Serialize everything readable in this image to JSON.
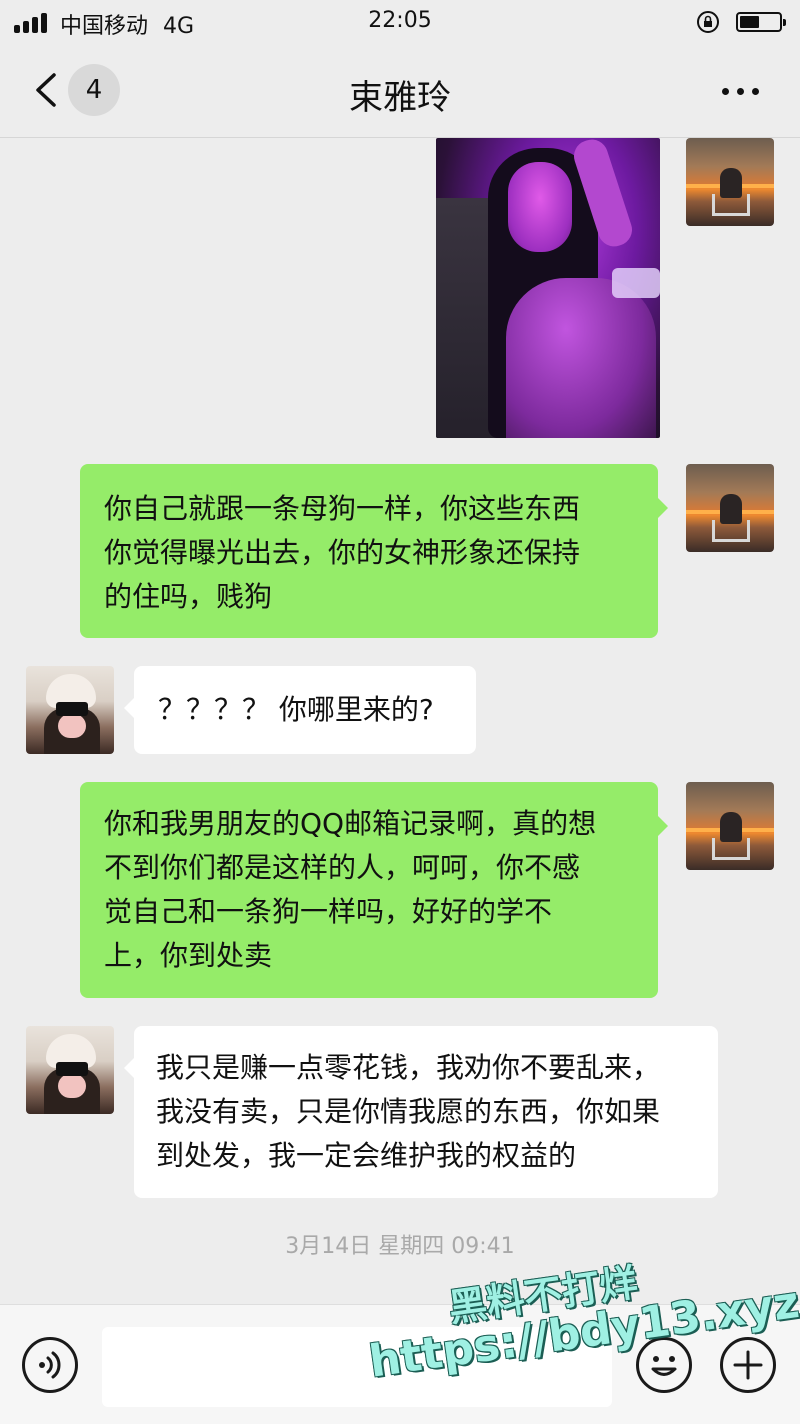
{
  "status_bar": {
    "carrier": "中国移动",
    "network": "4G",
    "time": "22:05",
    "battery_level": 0.5
  },
  "nav": {
    "back_badge": "4",
    "title": "束雅玲"
  },
  "messages": [
    {
      "sender": "self",
      "type": "image"
    },
    {
      "sender": "self",
      "type": "text",
      "lines": [
        "你自己就跟一条母狗一样，你这些东西",
        "你觉得曝光出去，你的女神形象还保持",
        "的住吗，贱狗"
      ]
    },
    {
      "sender": "other",
      "type": "text",
      "lines": [
        "？？？？ 你哪里来的?"
      ]
    },
    {
      "sender": "self",
      "type": "text",
      "lines": [
        "你和我男朋友的QQ邮箱记录啊，真的想",
        "不到你们都是这样的人，呵呵，你不感",
        "觉自己和一条狗一样吗，好好的学不",
        "上，你到处卖"
      ]
    },
    {
      "sender": "other",
      "type": "text",
      "lines": [
        "我只是赚一点零花钱，我劝你不要乱来，",
        "我没有卖，只是你情我愿的东西，你如果",
        "到处发，我一定会维护我的权益的"
      ]
    }
  ],
  "timestamp": "3月14日 星期四 09:41",
  "input": {
    "value": ""
  },
  "watermark": {
    "line1": "黑料不打烊",
    "line2": "https://bdy13.xyz"
  },
  "colors": {
    "self_bubble": "#95ec69",
    "other_bubble": "#ffffff",
    "background": "#ededed"
  }
}
